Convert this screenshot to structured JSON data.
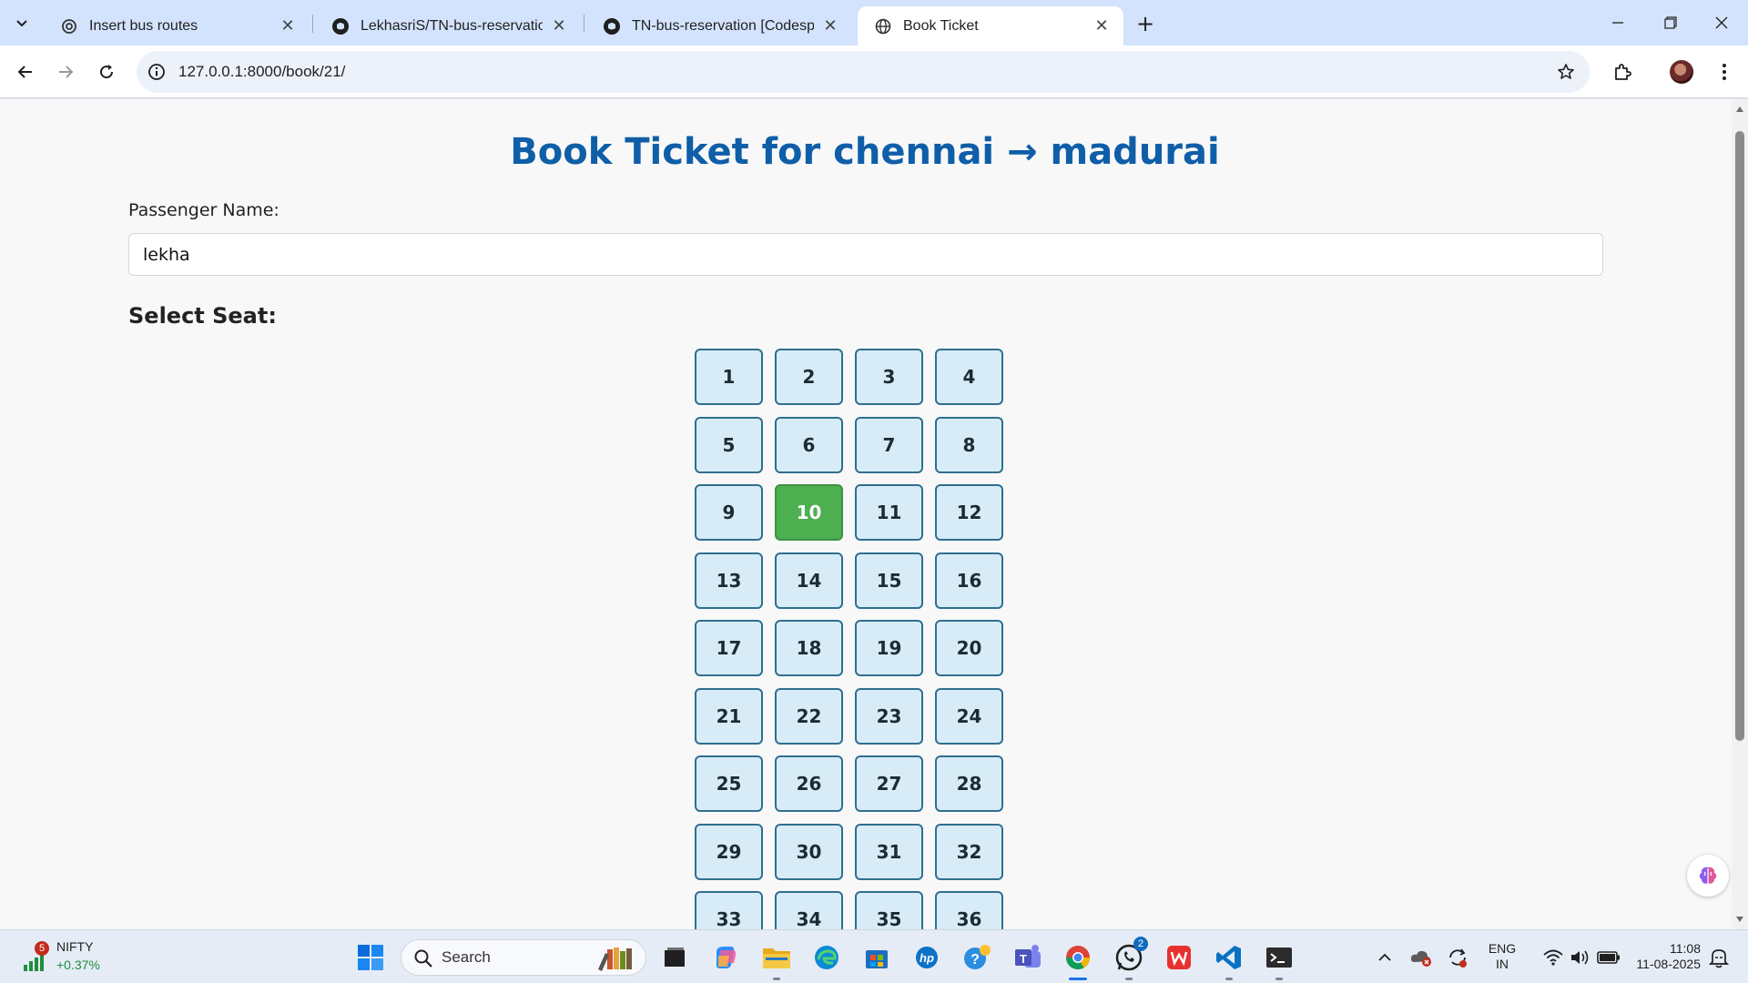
{
  "browser": {
    "tabs": [
      {
        "title": "Insert bus routes",
        "icon": "openai-icon"
      },
      {
        "title": "LekhasriS/TN-bus-reservation",
        "icon": "github-icon"
      },
      {
        "title": "TN-bus-reservation [Codespaces",
        "icon": "github-icon"
      },
      {
        "title": "Book Ticket",
        "icon": "globe-icon",
        "active": true
      }
    ],
    "url": "127.0.0.1:8000/book/21/"
  },
  "page": {
    "title": "Book Ticket for chennai → madurai",
    "passenger_label": "Passenger Name:",
    "passenger_value": "lekha",
    "seat_heading": "Select Seat:",
    "seats": [
      "1",
      "2",
      "3",
      "4",
      "5",
      "6",
      "7",
      "8",
      "9",
      "10",
      "11",
      "12",
      "13",
      "14",
      "15",
      "16",
      "17",
      "18",
      "19",
      "20",
      "21",
      "22",
      "23",
      "24",
      "25",
      "26",
      "27",
      "28",
      "29",
      "30",
      "31",
      "32",
      "33",
      "34",
      "35",
      "36"
    ],
    "selected_seat": "10",
    "colors": {
      "title": "#0f5ea8",
      "seat": "#d8ecf7",
      "seat_border": "#2f6f8f",
      "selected": "#4caf50"
    }
  },
  "taskbar": {
    "nifty_badge": "5",
    "nifty_name": "NIFTY",
    "nifty_change": "+0.37%",
    "search_label": "Search",
    "whatsapp_badge": "2",
    "lang_line1": "ENG",
    "lang_line2": "IN",
    "time": "11:08",
    "date": "11-08-2025"
  }
}
